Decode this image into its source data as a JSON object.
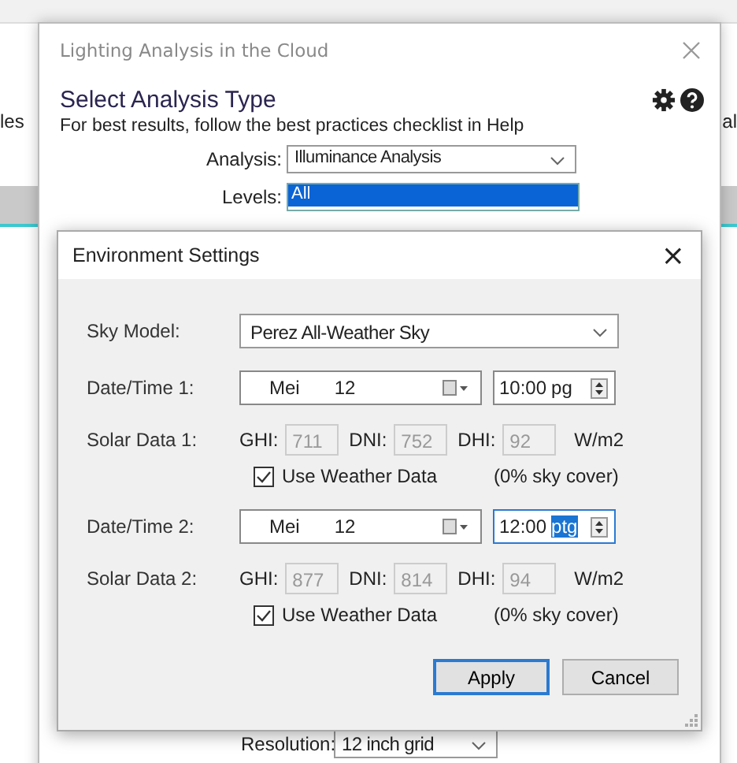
{
  "background": {
    "left_fragment": "les",
    "right_fragment": "al"
  },
  "dialog": {
    "title": "Lighting Analysis in the Cloud",
    "heading": "Select Analysis Type",
    "subtitle": "For best results, follow the best practices checklist in Help",
    "analysis": {
      "label": "Analysis:",
      "value": "Illuminance Analysis"
    },
    "levels": {
      "label": "Levels:",
      "items": [
        {
          "label": "All",
          "selected": true
        }
      ]
    },
    "resolution": {
      "label": "Resolution:",
      "value": "12 inch grid"
    }
  },
  "environment": {
    "title": "Environment Settings",
    "close": "×",
    "sky_model": {
      "label": "Sky Model:",
      "value": "Perez All-Weather Sky"
    },
    "periods": [
      {
        "date_label": "Date/Time 1:",
        "month": "Mei",
        "day": "12",
        "time": "10:00",
        "meridiem": "pg",
        "meridiem_selected": false,
        "solar_label": "Solar Data 1:",
        "ghi_label": "GHI:",
        "ghi": "711",
        "dni_label": "DNI:",
        "dni": "752",
        "dhi_label": "DHI:",
        "dhi": "92",
        "unit": "W/m2",
        "use_weather": {
          "label": "Use Weather Data",
          "checked": true
        },
        "sky_cover": "(0% sky cover)"
      },
      {
        "date_label": "Date/Time 2:",
        "month": "Mei",
        "day": "12",
        "time": "12:00",
        "meridiem": "ptg",
        "meridiem_selected": true,
        "solar_label": "Solar Data 2:",
        "ghi_label": "GHI:",
        "ghi": "877",
        "dni_label": "DNI:",
        "dni": "814",
        "dhi_label": "DHI:",
        "dhi": "94",
        "unit": "W/m2",
        "use_weather": {
          "label": "Use Weather Data",
          "checked": true
        },
        "sky_cover": "(0% sky cover)"
      }
    ],
    "buttons": [
      {
        "label": "Apply",
        "default": true
      },
      {
        "label": "Cancel",
        "default": false
      }
    ]
  }
}
